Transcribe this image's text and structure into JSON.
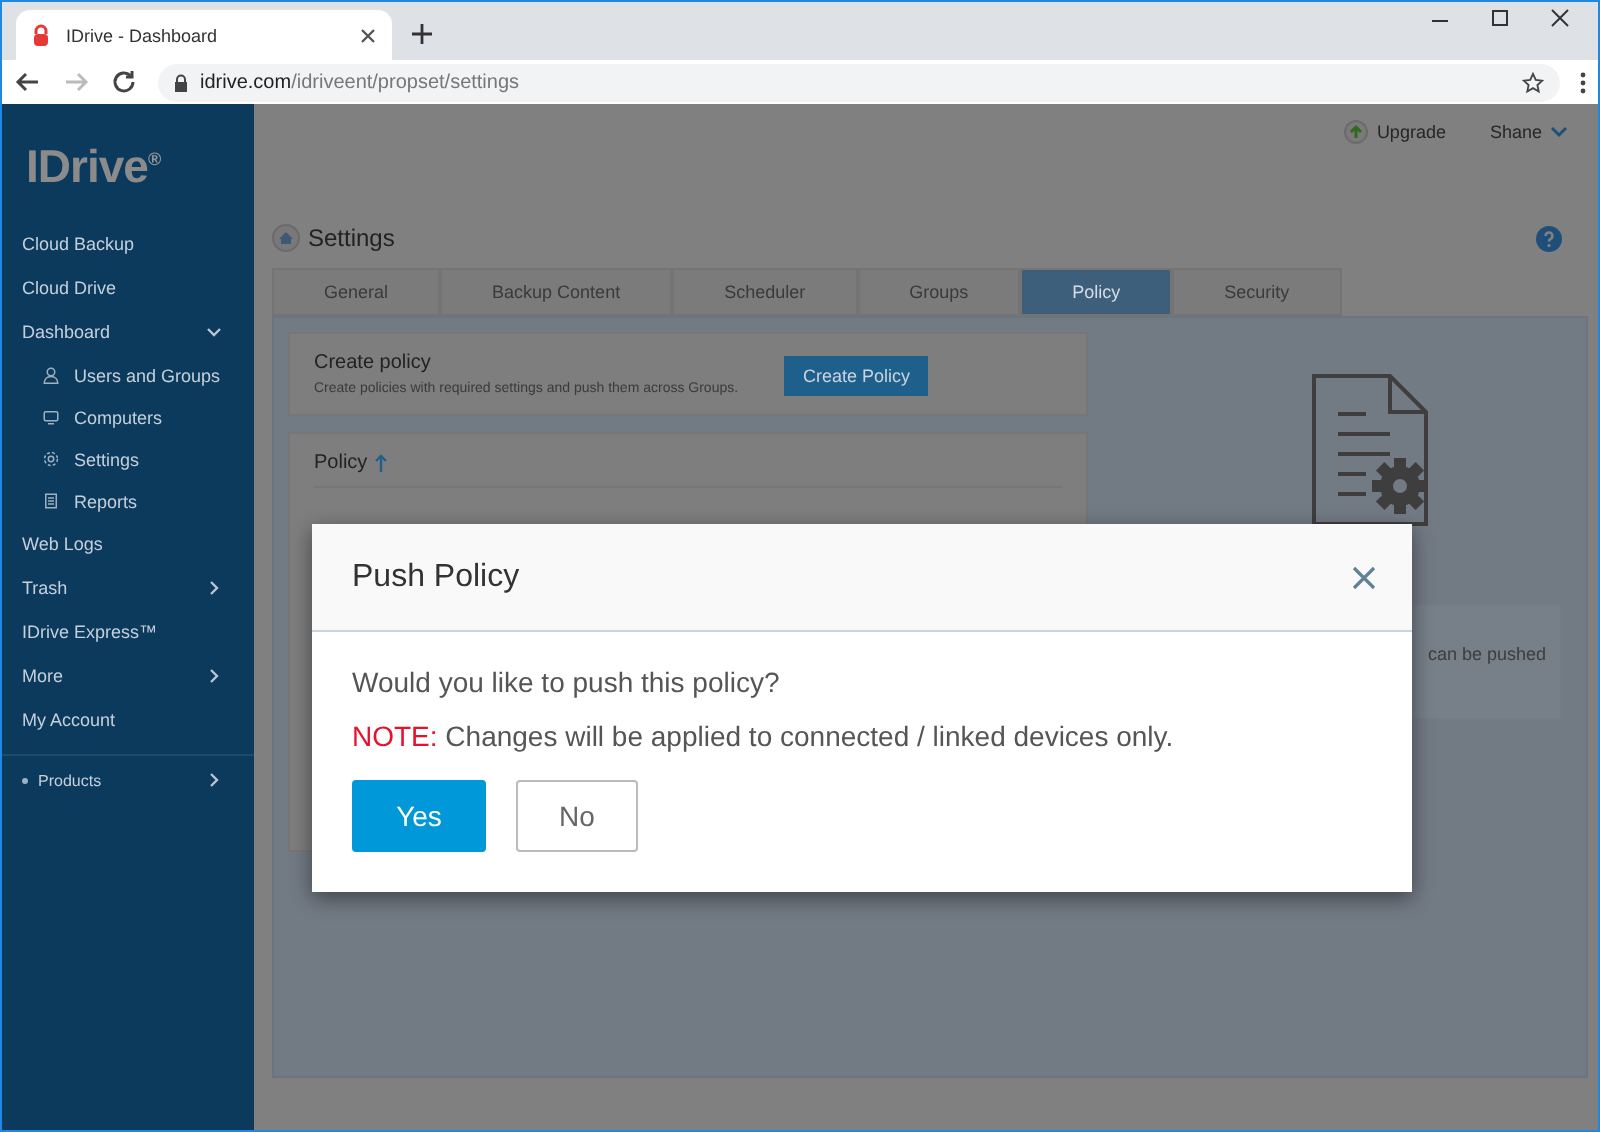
{
  "browser": {
    "tab_title": "IDrive - Dashboard",
    "url_domain": "idrive.com",
    "url_path": "/idriveent/propset/settings"
  },
  "sidebar": {
    "logo": "IDrive$^{®}$",
    "items": [
      {
        "label": "Cloud Backup",
        "kind": "link"
      },
      {
        "label": "Cloud Drive",
        "kind": "link"
      },
      {
        "label": "Dashboard",
        "kind": "group",
        "expanded": true,
        "children": [
          {
            "label": "Users and Groups"
          },
          {
            "label": "Computers"
          },
          {
            "label": "Settings"
          },
          {
            "label": "Reports"
          }
        ]
      },
      {
        "label": "Web Logs",
        "kind": "link"
      },
      {
        "label": "Trash",
        "kind": "group",
        "expanded": false
      },
      {
        "label": "IDrive Express™",
        "kind": "link"
      },
      {
        "label": "More",
        "kind": "group",
        "expanded": false
      },
      {
        "label": "My Account",
        "kind": "link"
      },
      {
        "label": "Products",
        "kind": "section",
        "expanded": false
      }
    ]
  },
  "header": {
    "upgrade": "Upgrade",
    "user": "Shane"
  },
  "page": {
    "title": "Settings",
    "tabs": [
      {
        "label": "General",
        "selected": false
      },
      {
        "label": "Backup Content",
        "selected": false
      },
      {
        "label": "Scheduler",
        "selected": false
      },
      {
        "label": "Groups",
        "selected": false
      },
      {
        "label": "Policy",
        "selected": true
      },
      {
        "label": "Security",
        "selected": false
      }
    ],
    "create_card": {
      "title": "Create policy",
      "description": "Create policies with required settings and push them across Groups.",
      "button": "Create Policy"
    },
    "policy_card": {
      "title": "Policy"
    },
    "side_text": "can be pushed"
  },
  "dialog": {
    "title": "Push Policy",
    "question": "Would you like to push this policy?",
    "note_label": "NOTE:",
    "note_text": "Changes will be applied to connected / linked devices only.",
    "buttons": [
      {
        "label": "Yes",
        "kind": "primary"
      },
      {
        "label": "No",
        "kind": "secondary"
      }
    ]
  }
}
